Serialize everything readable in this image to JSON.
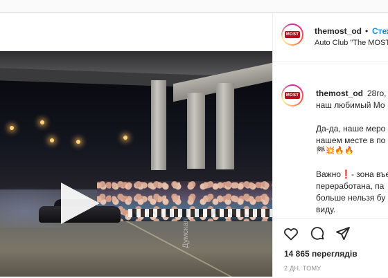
{
  "post": {
    "username": "themost_od",
    "follow_label": "Стеж",
    "subtitle": "Auto Club \"The MOST",
    "caption_user": "themost_od",
    "caption_lines": [
      "28го,",
      "наш любимый Мо",
      "",
      "Да-да, наше меро",
      "нашем месте в по",
      "🏁💥🔥🔥",
      "",
      "Важно❗- зона въе",
      "переработана, па",
      "больше нельзя бу",
      "виду."
    ],
    "views": "14 865 переглядів",
    "time": "2 ДН. ТОМУ",
    "logo_text": "MOST"
  },
  "video": {
    "watermark": "Думская"
  },
  "colors": {
    "follow": "#0095f6",
    "muted": "#8e8e8e"
  }
}
